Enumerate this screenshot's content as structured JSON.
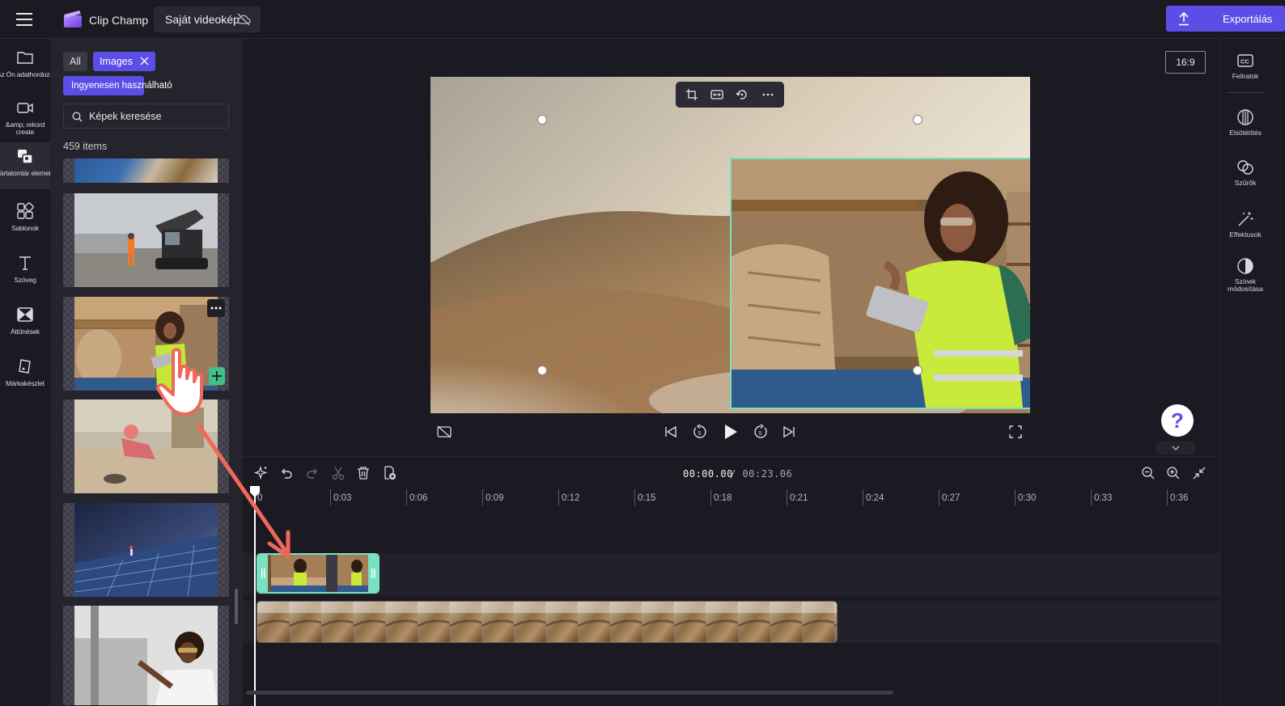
{
  "topbar": {
    "app_name": "Clip Champ",
    "project_title": "Saját videokép",
    "export_label": "Exportálás"
  },
  "left_rail": {
    "items": [
      {
        "label": "Az Ön adathordozója",
        "icon": "folder-icon"
      },
      {
        "label": "&amp; rekord\ncreate",
        "icon": "camera-icon"
      },
      {
        "label": "Tartalomtár elemeinek",
        "icon": "content-library-icon"
      },
      {
        "label": "Sablonok",
        "icon": "templates-icon"
      },
      {
        "label": "Szöveg",
        "icon": "text-icon"
      },
      {
        "label": "Áttűnések",
        "icon": "transitions-icon"
      },
      {
        "label": "Márkakészlet",
        "icon": "brand-kit-icon"
      }
    ]
  },
  "library": {
    "chip_all": "All",
    "chip_images": "Images",
    "chip_free": "Ingyenesen használható",
    "search_placeholder": "Képek keresése",
    "items_count": "459",
    "items_label": "items"
  },
  "preview": {
    "aspect_ratio": "16:9"
  },
  "right_rail": {
    "items": [
      {
        "label": "Feliratok",
        "icon": "captions-icon"
      },
      {
        "label": "Elsötétítés",
        "icon": "fade-icon"
      },
      {
        "label": "Szűrők",
        "icon": "filters-icon"
      },
      {
        "label": "Effektusok",
        "icon": "effects-icon"
      },
      {
        "label": "Színek módosítása",
        "icon": "adjust-colors-icon"
      }
    ]
  },
  "help": {
    "label": "?"
  },
  "timeline": {
    "current_time": "00:00.00",
    "total_time": "/ 00:23.06",
    "ruler": [
      "0",
      "0:03",
      "0:06",
      "0:09",
      "0:12",
      "0:15",
      "0:18",
      "0:21",
      "0:24",
      "0:27",
      "0:30",
      "0:33",
      "0:36"
    ]
  },
  "colors": {
    "accent": "#5b4ee6",
    "selection": "#79e0c0",
    "background": "#1b1a22",
    "panel": "#25242d",
    "arrow": "#f0685a"
  }
}
